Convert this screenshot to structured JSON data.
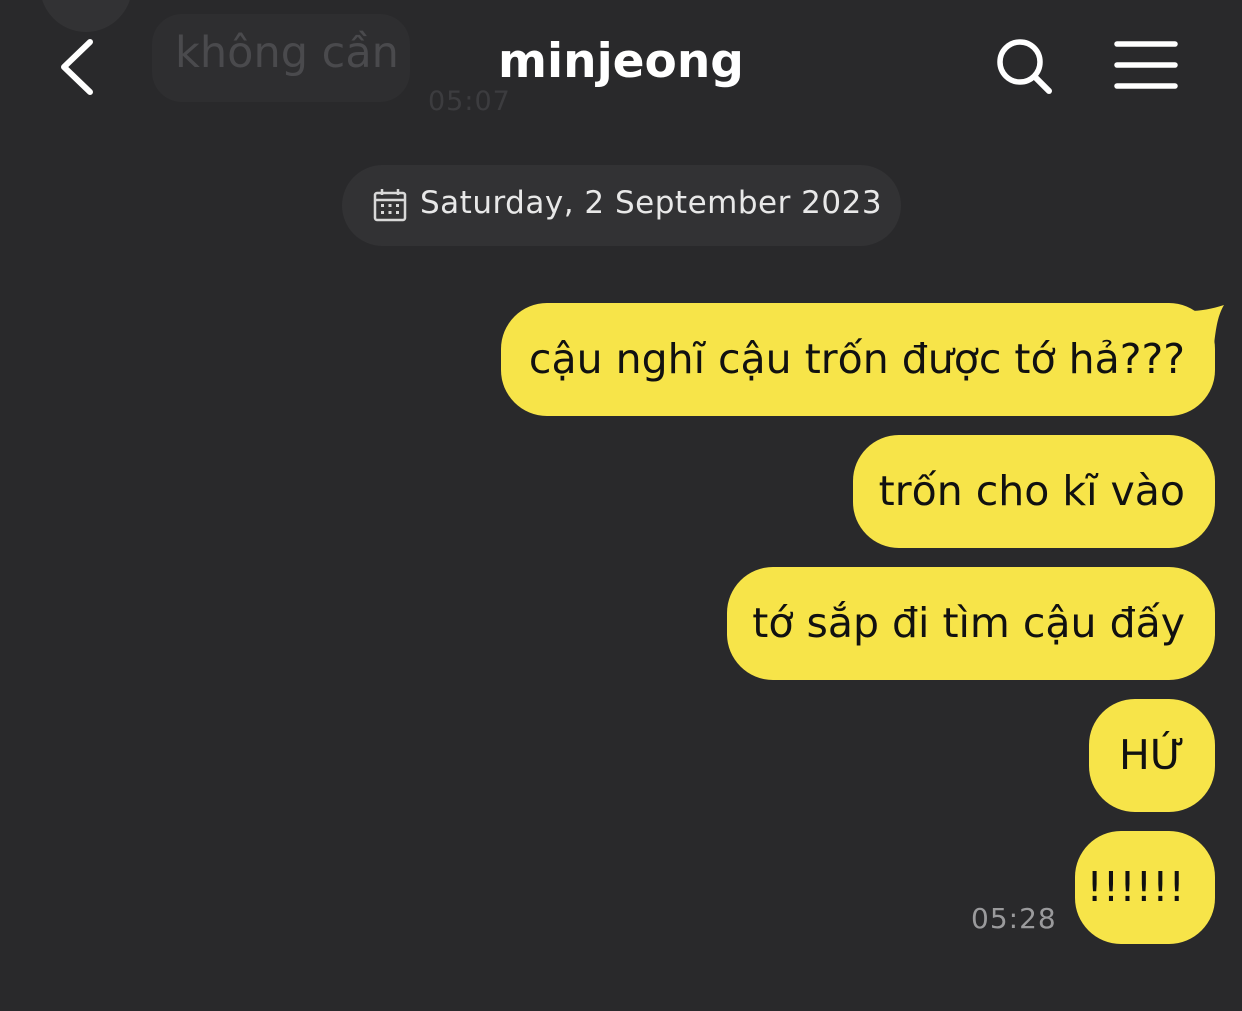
{
  "header": {
    "title": "minjeong",
    "back_icon": "chevron-left-icon",
    "search_icon": "search-icon",
    "menu_icon": "hamburger-menu-icon"
  },
  "previous_message": {
    "text": "không cần",
    "time": "05:07"
  },
  "date_divider": {
    "icon": "calendar-icon",
    "label": "Saturday, 2 September 2023"
  },
  "messages": [
    {
      "text": "cậu nghĩ cậu trốn được tớ hả???"
    },
    {
      "text": "trốn cho kĩ vào"
    },
    {
      "text": "tớ sắp đi tìm cậu đấy"
    },
    {
      "text": "HỨ"
    },
    {
      "text": "!!!!!!"
    }
  ],
  "last_time": "05:28",
  "colors": {
    "background": "#29292b",
    "bubble": "#f7e449",
    "date_pill": "#323234"
  }
}
